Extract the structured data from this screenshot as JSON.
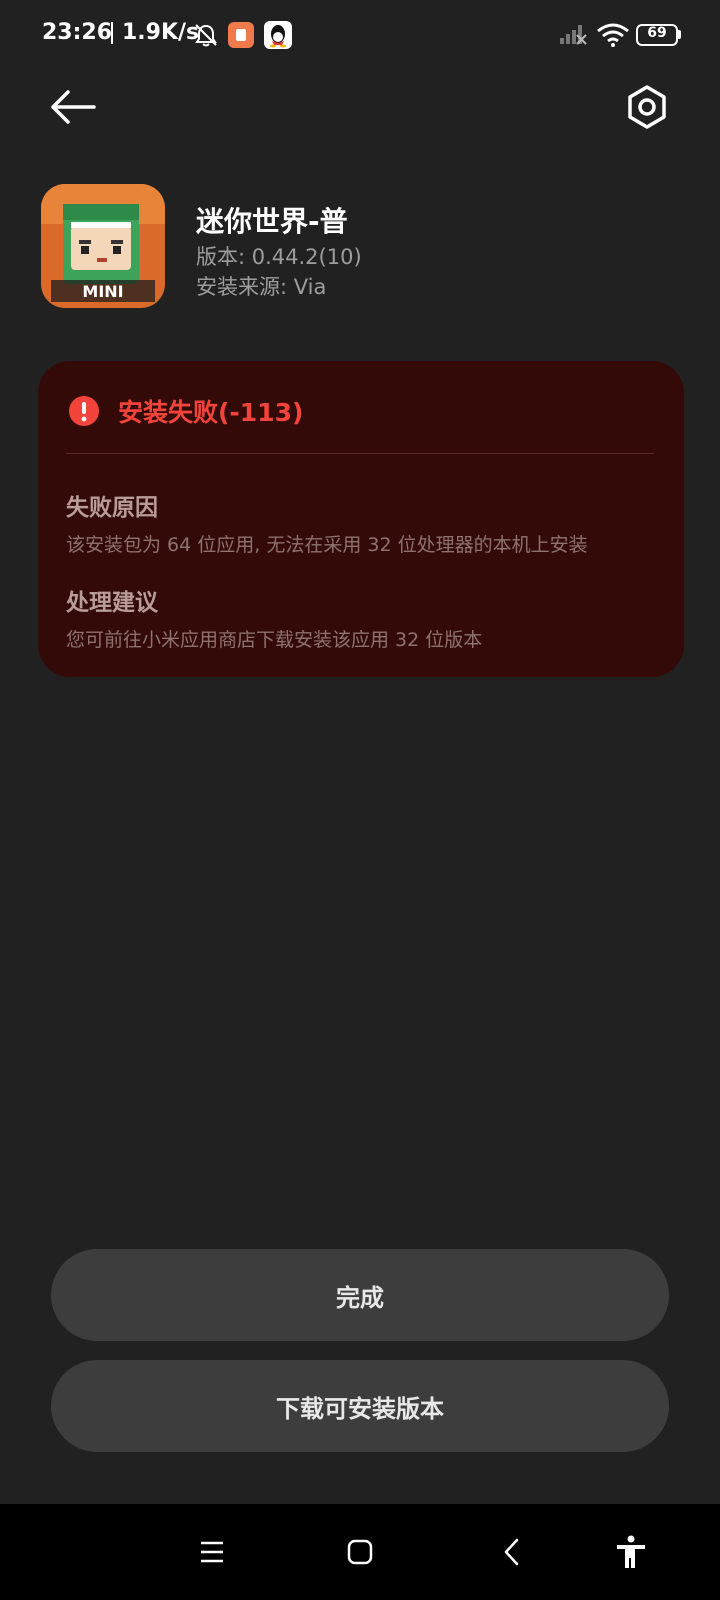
{
  "status_bar": {
    "time": "23:26",
    "net_speed": "1.9K/s",
    "battery": "69",
    "icons": [
      "bell-muted-icon",
      "app-notification-icon",
      "qq-penguin-icon",
      "signal-icon",
      "wifi-icon",
      "battery-icon"
    ]
  },
  "header": {
    "back_icon": "back-arrow-icon",
    "settings_icon": "settings-hexagon-icon"
  },
  "app": {
    "name": "迷你世界-普",
    "version": "版本: 0.44.2(10)",
    "source": "安装来源: Via"
  },
  "error": {
    "title": "安装失败(-113)",
    "reason_title": "失败原因",
    "reason_text": "该安装包为 64 位应用, 无法在采用 32 位处理器的本机上安装",
    "advice_title": "处理建议",
    "advice_text": "您可前往小米应用商店下载安装该应用 32 位版本",
    "color": "#f2443a",
    "card_bg": "#330a07"
  },
  "buttons": {
    "done": "完成",
    "download": "下载可安装版本"
  },
  "nav_bar": {
    "icons": [
      "menu-icon",
      "home-square-icon",
      "back-chevron-icon",
      "accessibility-icon"
    ]
  }
}
